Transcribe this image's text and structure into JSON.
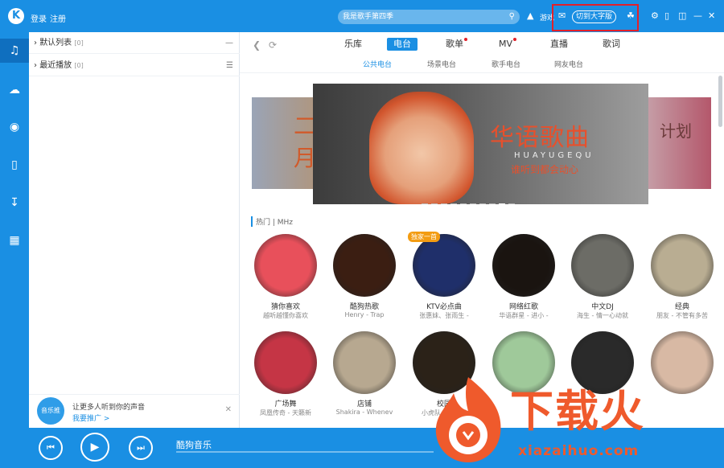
{
  "topbar": {
    "logo": "K",
    "login": "登录",
    "register": "注册",
    "search_placeholder": "我是歌手第四季",
    "game": "游戏",
    "switch_mode": "切到大字版"
  },
  "left_panel": {
    "default_list": "默认列表",
    "default_count": "[0]",
    "recent": "最近播放",
    "recent_count": "[0]",
    "promo_badge": "音乐推",
    "promo_title": "让更多人听到你的声音",
    "promo_link": "我要推广 >"
  },
  "tabs": [
    {
      "label": "乐库",
      "active": false,
      "dot": false
    },
    {
      "label": "电台",
      "active": true,
      "dot": false
    },
    {
      "label": "歌单",
      "active": false,
      "dot": true
    },
    {
      "label": "MV",
      "active": false,
      "dot": true
    },
    {
      "label": "直播",
      "active": false,
      "dot": false
    },
    {
      "label": "歌词",
      "active": false,
      "dot": false
    }
  ],
  "subtabs": [
    {
      "label": "公共电台",
      "active": true
    },
    {
      "label": "场景电台",
      "active": false
    },
    {
      "label": "歌手电台",
      "active": false
    },
    {
      "label": "网友电台",
      "active": false
    }
  ],
  "banner": {
    "left_text": "二月",
    "right_text": "计划",
    "title": "华语歌曲",
    "pinyin": "HUAYUGEQU",
    "subtitle": "谁听到都会动心"
  },
  "section_label": "热门 | MHz",
  "radios_row1": [
    {
      "name": "猜你喜欢",
      "desc": "越听越懂你喜欢",
      "bg": "#e8505b",
      "tag": ""
    },
    {
      "name": "酷狗热歌",
      "desc": "Henry - Trap",
      "bg": "#3b1e12",
      "tag": ""
    },
    {
      "name": "KTV必点曲",
      "desc": "张惠妹、张雨生 -",
      "bg": "#1f2f6a",
      "tag": "独家一首"
    },
    {
      "name": "网络红歌",
      "desc": "华语群星 - 进小 -",
      "bg": "#1a1410",
      "tag": ""
    },
    {
      "name": "中文DJ",
      "desc": "海生 - 情一心动就",
      "bg": "#6c6c66",
      "tag": ""
    },
    {
      "name": "经典",
      "desc": "朋友 - 不管有多苦",
      "bg": "#b9ad92",
      "tag": ""
    }
  ],
  "radios_row2": [
    {
      "name": "广场舞",
      "desc": "凤凰传奇 - 天籁新",
      "bg": "#c53545"
    },
    {
      "name": "店铺",
      "desc": "Shakira - Whenev",
      "bg": "#b7a890"
    },
    {
      "name": "校园",
      "desc": "小虎队 - 青苹果",
      "bg": "#2b2218"
    },
    {
      "name": "",
      "desc": "",
      "bg": "#9fc99a"
    },
    {
      "name": "",
      "desc": "",
      "bg": "#2a2a2a"
    },
    {
      "name": "",
      "desc": "",
      "bg": "#d8b9a4"
    }
  ],
  "player": {
    "now_playing": "酷狗音乐"
  },
  "watermark": {
    "title": "下载火",
    "domain": "xiazaihuo.com"
  }
}
